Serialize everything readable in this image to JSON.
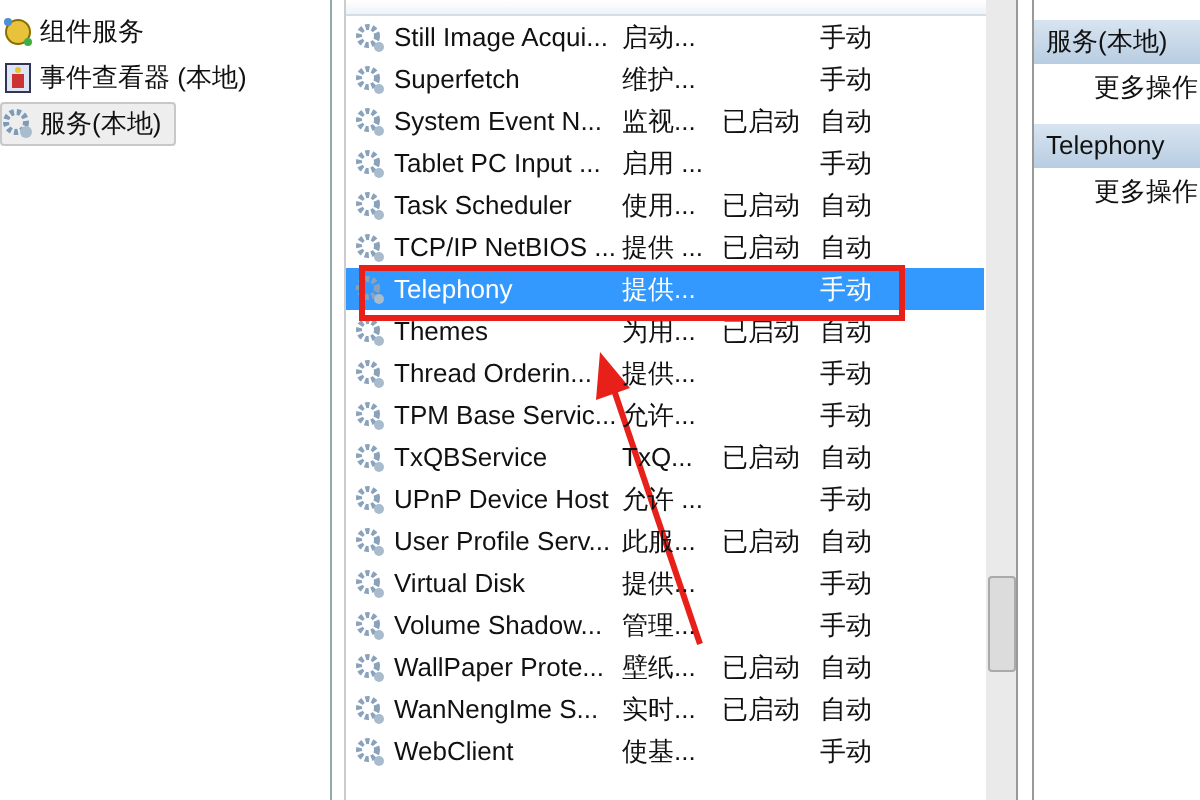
{
  "tree": {
    "items": [
      {
        "label": "组件服务",
        "kind": "component",
        "selected": false
      },
      {
        "label": "事件查看器 (本地)",
        "kind": "event",
        "selected": false
      },
      {
        "label": "服务(本地)",
        "kind": "service",
        "selected": true
      }
    ]
  },
  "services": {
    "rows": [
      {
        "name": "Still Image Acqui...",
        "description": "启动...",
        "status": "",
        "startup": "手动",
        "selected": false
      },
      {
        "name": "Superfetch",
        "description": "维护...",
        "status": "",
        "startup": "手动",
        "selected": false
      },
      {
        "name": "System Event N...",
        "description": "监视...",
        "status": "已启动",
        "startup": "自动",
        "selected": false
      },
      {
        "name": "Tablet PC Input ...",
        "description": "启用 ...",
        "status": "",
        "startup": "手动",
        "selected": false
      },
      {
        "name": "Task Scheduler",
        "description": "使用...",
        "status": "已启动",
        "startup": "自动",
        "selected": false
      },
      {
        "name": "TCP/IP NetBIOS ...",
        "description": "提供 ...",
        "status": "已启动",
        "startup": "自动",
        "selected": false
      },
      {
        "name": "Telephony",
        "description": "提供...",
        "status": "",
        "startup": "手动",
        "selected": true
      },
      {
        "name": "Themes",
        "description": "为用...",
        "status": "已启动",
        "startup": "自动",
        "selected": false
      },
      {
        "name": "Thread Orderin...",
        "description": "提供...",
        "status": "",
        "startup": "手动",
        "selected": false
      },
      {
        "name": "TPM Base Servic...",
        "description": "允许...",
        "status": "",
        "startup": "手动",
        "selected": false
      },
      {
        "name": "TxQBService",
        "description": "TxQ...",
        "status": "已启动",
        "startup": "自动",
        "selected": false
      },
      {
        "name": "UPnP Device Host",
        "description": "允许 ...",
        "status": "",
        "startup": "手动",
        "selected": false
      },
      {
        "name": "User Profile Serv...",
        "description": "此服...",
        "status": "已启动",
        "startup": "自动",
        "selected": false
      },
      {
        "name": "Virtual Disk",
        "description": "提供...",
        "status": "",
        "startup": "手动",
        "selected": false
      },
      {
        "name": "Volume Shadow...",
        "description": "管理...",
        "status": "",
        "startup": "手动",
        "selected": false
      },
      {
        "name": "WallPaper Prote...",
        "description": "壁纸...",
        "status": "已启动",
        "startup": "自动",
        "selected": false
      },
      {
        "name": "WanNengIme S...",
        "description": "实时...",
        "status": "已启动",
        "startup": "自动",
        "selected": false
      },
      {
        "name": "WebClient",
        "description": "使基...",
        "status": "",
        "startup": "手动",
        "selected": false
      }
    ]
  },
  "actions": {
    "sections": [
      {
        "title": "服务(本地)",
        "items": [
          "更多操作"
        ]
      },
      {
        "title": "Telephony",
        "items": [
          "更多操作"
        ]
      }
    ]
  }
}
